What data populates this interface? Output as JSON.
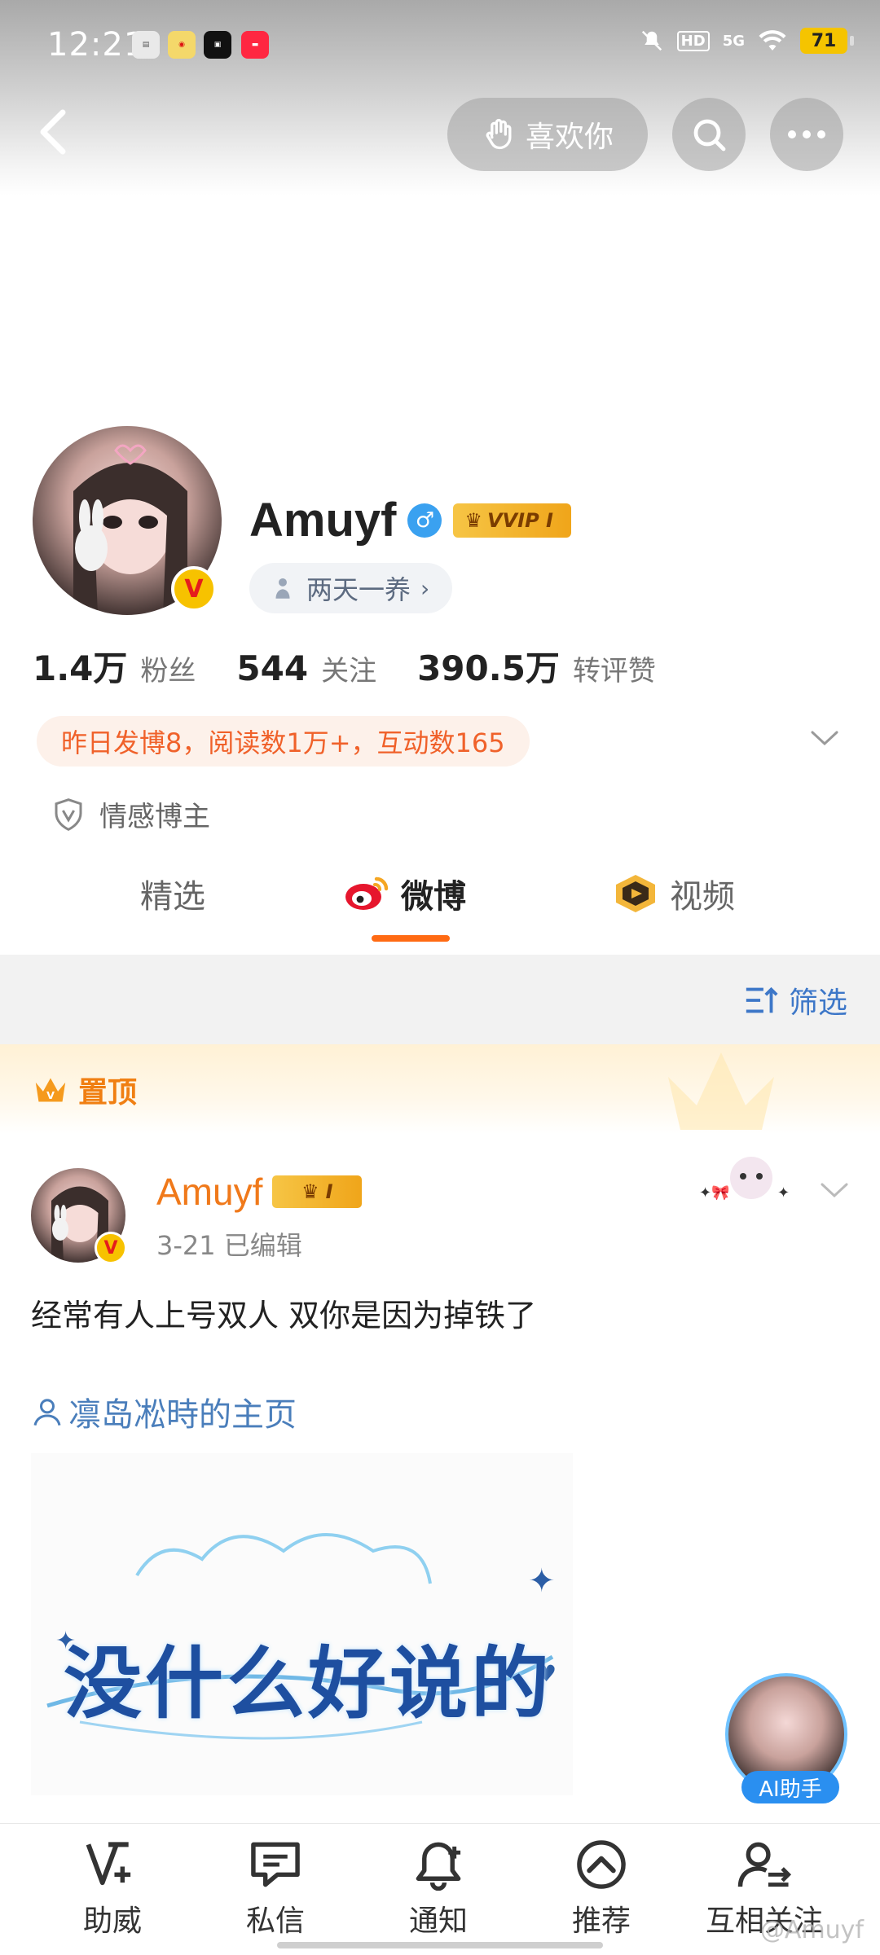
{
  "status_bar": {
    "time": "12:21",
    "battery": "71",
    "network": "5G",
    "hd": "HD"
  },
  "nav": {
    "back_icon": "chevron-left-icon",
    "like_label": "喜欢你",
    "search_icon": "search-icon",
    "more_icon": "more-icon"
  },
  "profile": {
    "name": "Amuyf",
    "vip_label": "VVIP I",
    "tag": "两天一养",
    "stats": [
      {
        "value": "1.4万",
        "label": "粉丝"
      },
      {
        "value": "544",
        "label": "关注"
      },
      {
        "value": "390.5万",
        "label": "转评赞"
      }
    ],
    "summary": "昨日发博8，阅读数1万+，互动数165",
    "certification": "情感博主"
  },
  "tabs": [
    {
      "label": "精选"
    },
    {
      "label": "微博"
    },
    {
      "label": "视频"
    }
  ],
  "filter": {
    "label": "筛选"
  },
  "pinned": {
    "label": "置顶"
  },
  "post": {
    "author": "Amuyf",
    "vip_label": "I",
    "meta": "3-21  已编辑",
    "text": "经常有人上号双人 双你是因为掉铁了",
    "link": "凛岛凇時的主页",
    "image_text": "没什么好说的"
  },
  "ai_helper": {
    "label": "AI助手"
  },
  "bottom_nav": [
    {
      "label": "助威",
      "icon": "cheer-icon"
    },
    {
      "label": "私信",
      "icon": "message-icon"
    },
    {
      "label": "通知",
      "icon": "bell-icon"
    },
    {
      "label": "推荐",
      "icon": "recommend-icon"
    },
    {
      "label": "互相关注",
      "icon": "mutual-follow-icon"
    }
  ],
  "watermark": "@Amuyf",
  "colors": {
    "accent_orange": "#ff6a13",
    "link_blue": "#4a7ebb",
    "weibo_red": "#e51c1c",
    "vip_gold": "#f6c545"
  }
}
